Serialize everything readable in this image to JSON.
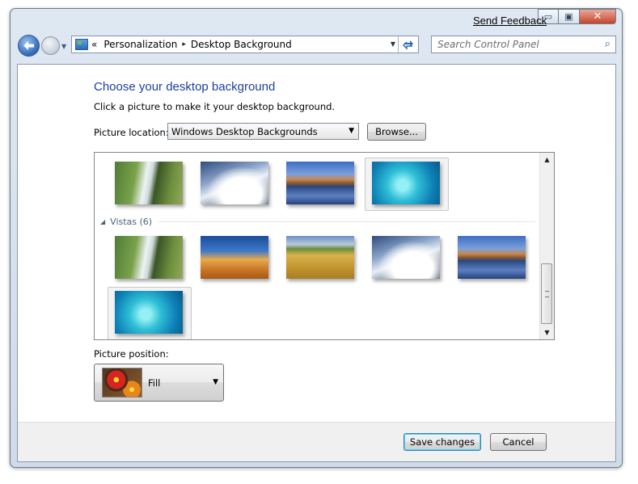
{
  "window": {
    "send_feedback": "Send Feedback",
    "buttons": {
      "minimize": "▭",
      "maximize": "▣",
      "close": "✕"
    }
  },
  "address_bar": {
    "overflow": "«",
    "crumbs": [
      "Personalization",
      "Desktop Background"
    ],
    "separator": "▸"
  },
  "search": {
    "placeholder": "Search Control Panel"
  },
  "content": {
    "heading": "Choose your desktop background",
    "instruction": "Click a picture to make it your desktop background.",
    "picture_location_label": "Picture location:",
    "picture_location_value": "Windows Desktop Backgrounds",
    "browse_label": "Browse...",
    "group_label": "Vistas (6)",
    "picture_position_label": "Picture position:",
    "picture_position_value": "Fill"
  },
  "gallery": {
    "top_row": [
      "waterfall",
      "snowy-mountains",
      "mountain-lake",
      "underwater-fish"
    ],
    "selected_top_index": 3,
    "vistas": [
      "waterfall",
      "sand-dune",
      "wheat-field",
      "snowy-mountains",
      "mountain-lake",
      "underwater-fish"
    ],
    "selected_vista_index": 5
  },
  "footer": {
    "save_label": "Save changes",
    "cancel_label": "Cancel"
  },
  "icons": {
    "back": "back-arrow-icon",
    "forward": "forward-arrow-icon",
    "search": "magnifier-icon",
    "refresh": "refresh-icon",
    "control_panel": "control-panel-icon"
  }
}
